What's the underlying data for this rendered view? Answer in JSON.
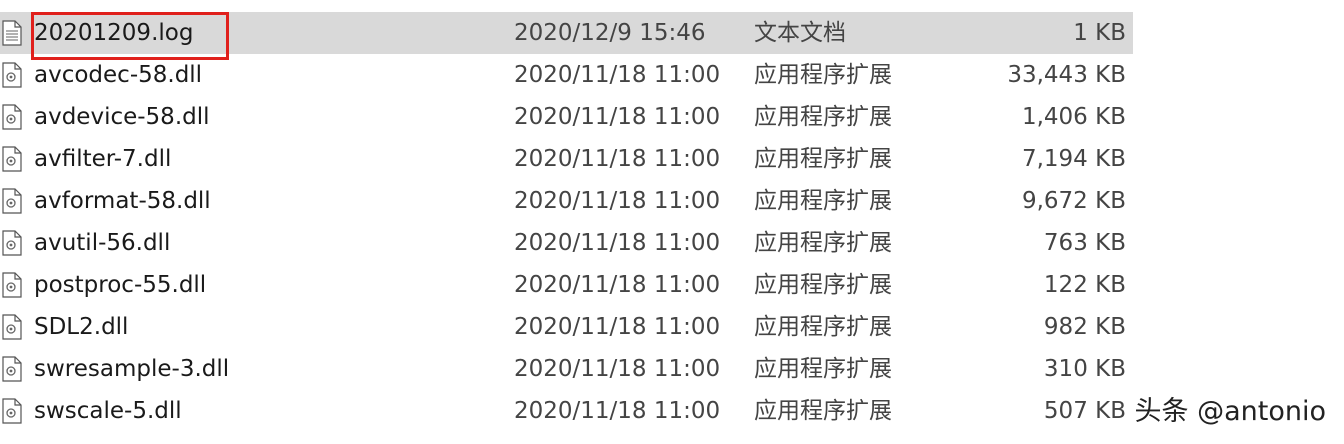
{
  "files": [
    {
      "name": "20201209.log",
      "date": "2020/12/9 15:46",
      "type": "文本文档",
      "size": "1 KB",
      "icon": "text-file-icon",
      "selected": true
    },
    {
      "name": "avcodec-58.dll",
      "date": "2020/11/18 11:00",
      "type": "应用程序扩展",
      "size": "33,443 KB",
      "icon": "dll-file-icon"
    },
    {
      "name": "avdevice-58.dll",
      "date": "2020/11/18 11:00",
      "type": "应用程序扩展",
      "size": "1,406 KB",
      "icon": "dll-file-icon"
    },
    {
      "name": "avfilter-7.dll",
      "date": "2020/11/18 11:00",
      "type": "应用程序扩展",
      "size": "7,194 KB",
      "icon": "dll-file-icon"
    },
    {
      "name": "avformat-58.dll",
      "date": "2020/11/18 11:00",
      "type": "应用程序扩展",
      "size": "9,672 KB",
      "icon": "dll-file-icon"
    },
    {
      "name": "avutil-56.dll",
      "date": "2020/11/18 11:00",
      "type": "应用程序扩展",
      "size": "763 KB",
      "icon": "dll-file-icon"
    },
    {
      "name": "postproc-55.dll",
      "date": "2020/11/18 11:00",
      "type": "应用程序扩展",
      "size": "122 KB",
      "icon": "dll-file-icon"
    },
    {
      "name": "SDL2.dll",
      "date": "2020/11/18 11:00",
      "type": "应用程序扩展",
      "size": "982 KB",
      "icon": "dll-file-icon"
    },
    {
      "name": "swresample-3.dll",
      "date": "2020/11/18 11:00",
      "type": "应用程序扩展",
      "size": "310 KB",
      "icon": "dll-file-icon"
    },
    {
      "name": "swscale-5.dll",
      "date": "2020/11/18 11:00",
      "type": "应用程序扩展",
      "size": "507 KB",
      "icon": "dll-file-icon"
    }
  ],
  "watermark": "头条 @antonio",
  "colors": {
    "selection": "#d9d9d9",
    "highlight_border": "#e0201c"
  }
}
